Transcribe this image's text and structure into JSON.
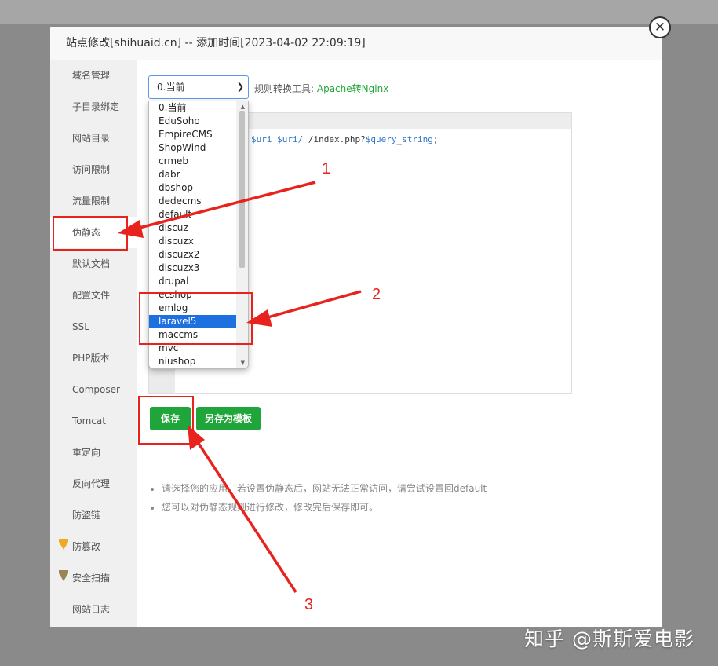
{
  "dialog": {
    "title": "站点修改[shihuaid.cn] -- 添加时间[2023-04-02 22:09:19]",
    "close_symbol": "✕"
  },
  "sidebar": {
    "items": [
      {
        "label": "域名管理"
      },
      {
        "label": "子目录绑定"
      },
      {
        "label": "网站目录"
      },
      {
        "label": "访问限制"
      },
      {
        "label": "流量限制"
      },
      {
        "label": "伪静态",
        "active": true
      },
      {
        "label": "默认文档"
      },
      {
        "label": "配置文件"
      },
      {
        "label": "SSL"
      },
      {
        "label": "PHP版本"
      },
      {
        "label": "Composer"
      },
      {
        "label": "Tomcat"
      },
      {
        "label": "重定向"
      },
      {
        "label": "反向代理"
      },
      {
        "label": "防盗链"
      },
      {
        "label": "防篡改",
        "icon": "gold-gem-icon"
      },
      {
        "label": "安全扫描",
        "icon": "gem-icon"
      },
      {
        "label": "网站日志"
      }
    ]
  },
  "rewrite": {
    "selected": "0.当前",
    "rule_tool_label": "规则转换工具:",
    "rule_tool_link": "Apache转Nginx",
    "code_prefix": "$uri $uri/",
    "code_suffix": " /index.php?",
    "code_var": "$query_string",
    "code_end": ";",
    "options": [
      "0.当前",
      "EduSoho",
      "EmpireCMS",
      "ShopWind",
      "crmeb",
      "dabr",
      "dbshop",
      "dedecms",
      "default",
      "discuz",
      "discuzx",
      "discuzx2",
      "discuzx3",
      "drupal",
      "ecshop",
      "emlog",
      "laravel5",
      "maccms",
      "mvc",
      "niushop"
    ],
    "highlighted_option": "laravel5",
    "save_label": "保存",
    "save_template_label": "另存为模板",
    "tips": [
      "请选择您的应用，若设置伪静态后，网站无法正常访问，请尝试设置回default",
      "您可以对伪静态规则进行修改，修改完后保存即可。"
    ]
  },
  "annotations": {
    "numbers": [
      "1",
      "2",
      "3"
    ],
    "color": "#e8231e"
  },
  "watermark": "知乎 @斯斯爱电影",
  "colors": {
    "accent_green": "#20a53a",
    "selection_blue": "#1e6fe0",
    "overlay": "#8a8a8a"
  }
}
